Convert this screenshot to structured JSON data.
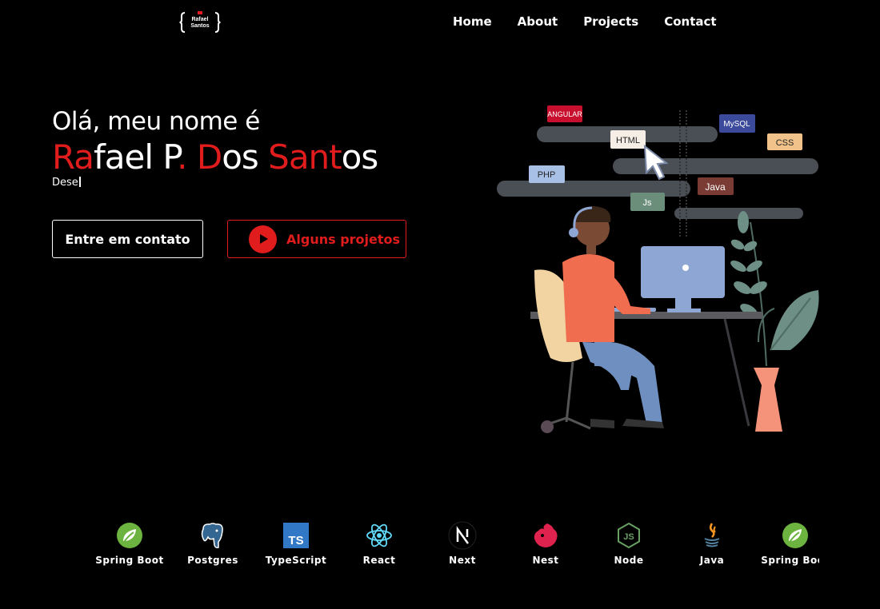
{
  "logo": {
    "line1": "Rafael",
    "line2": "Santos"
  },
  "nav": {
    "home": "Home",
    "about": "About",
    "projects": "Projects",
    "contact": "Contact"
  },
  "hero": {
    "greeting": "Olá, meu nome é",
    "name_parts": [
      "Ra",
      "fael P",
      ". ",
      "D",
      "os ",
      "Sant",
      "os"
    ],
    "typing": "Dese",
    "contact_button": "Entre em contato",
    "projects_button": "Alguns projetos"
  },
  "tags": {
    "angular": "ANGULAR",
    "mysql": "MySQL",
    "html": "HTML",
    "css": "CSS",
    "php": "PHP",
    "java": "Java",
    "js": "Js"
  },
  "colors": {
    "accent": "#e01c1c",
    "background": "#000000",
    "text": "#ffffff"
  },
  "tech": [
    {
      "label": "Spring Boot",
      "icon": "spring-icon"
    },
    {
      "label": "Postgres",
      "icon": "postgres-icon"
    },
    {
      "label": "TypeScript",
      "icon": "typescript-icon"
    },
    {
      "label": "React",
      "icon": "react-icon"
    },
    {
      "label": "Next",
      "icon": "next-icon"
    },
    {
      "label": "Nest",
      "icon": "nest-icon"
    },
    {
      "label": "Node",
      "icon": "node-icon"
    },
    {
      "label": "Java",
      "icon": "java-icon"
    },
    {
      "label": "Spring Boot",
      "icon": "spring-icon"
    }
  ]
}
